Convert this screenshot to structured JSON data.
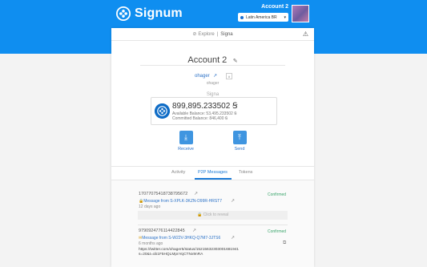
{
  "header": {
    "brand": "Signum",
    "account_title": "Account 2",
    "network": "Latin America BR"
  },
  "panel": {
    "breadcrumb": {
      "explore": "Explore",
      "separator": "|",
      "current": "Signa"
    },
    "account_name": "Account 2",
    "alias": "ohager",
    "alias_sub": "ohager",
    "balance_label": "Signa",
    "balance_main": "899,895.233502 Ꞩ",
    "available_balance": "Available Balance: 53,495.233502 Ꞩ",
    "committed_balance": "Committed Balance: 846,400 Ꞩ",
    "actions": {
      "receive": "Receive",
      "send": "Send"
    },
    "tabs": [
      "Activity",
      "P2P Messages",
      "Tokens"
    ],
    "active_tab": "P2P Messages",
    "messages": [
      {
        "tx_id": "17077075418738795672",
        "status": "Confirmed",
        "from": "Message from S-XPLK-3KZN-D99R-HRST7",
        "ago": "12 days ago",
        "reveal_label": "Click to reveal"
      },
      {
        "tx_id": "9790924776114422845",
        "status": "Confirmed",
        "from": "Message from S-W22V-3HKQ-Q7M7-3JTS6",
        "ago": "6 months ago",
        "text_line1": "https://twitter.com/ohager5/status/15215632303001681941",
        "text_line2": "s=20&t=ob1F5HQLMpnYqCTNx9nRA"
      }
    ]
  },
  "colors": {
    "topbar": "#0f8ef0",
    "accent": "#1b7ad6",
    "confirmed": "#3aa56b"
  }
}
